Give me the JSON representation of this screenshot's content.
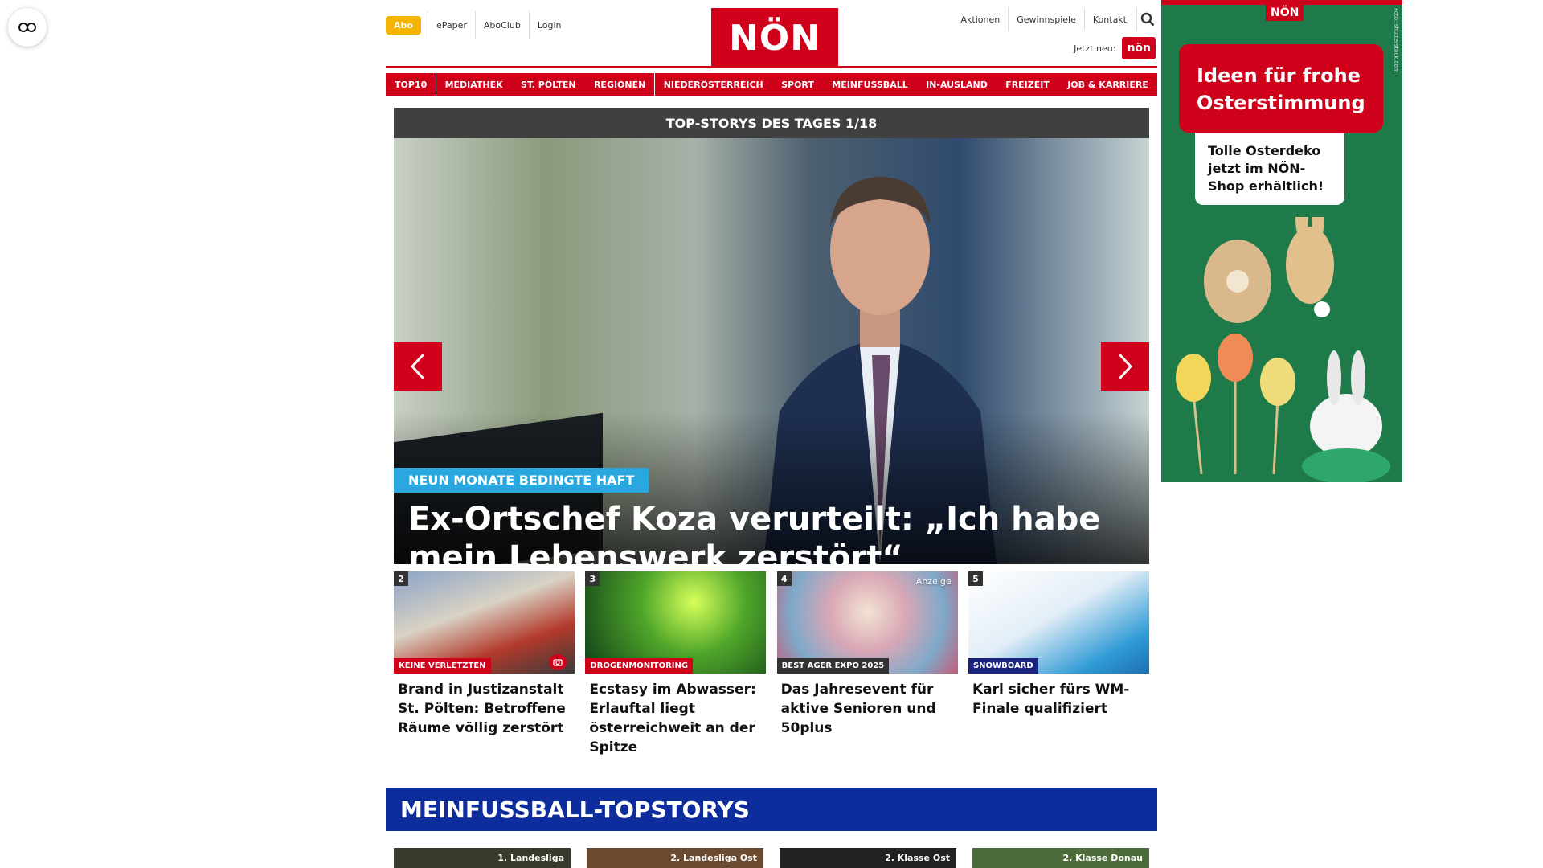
{
  "accessibility": {
    "label": ""
  },
  "header": {
    "abo": "Abo",
    "left_links": [
      "ePaper",
      "AboClub",
      "Login"
    ],
    "logo": "NÖN",
    "right_links": [
      "Aktionen",
      "Gewinnspiele",
      "Kontakt"
    ],
    "jetzt_neu": "Jetzt neu:",
    "jetzt_badge": "nön"
  },
  "nav": [
    "TOP10",
    "MEDIATHEK",
    "ST. PÖLTEN",
    "REGIONEN",
    "NIEDERÖSTERREICH",
    "SPORT",
    "MEINFUSSBALL",
    "IN-AUSLAND",
    "FREIZEIT",
    "JOB & KARRIERE"
  ],
  "hero": {
    "bar_title": "TOP-STORYS DES TAGES 1/18",
    "kicker": "NEUN MONATE BEDINGTE HAFT",
    "title": "Ex-Ortschef Koza verurteilt: „Ich habe mein Lebenswerk zerstört“"
  },
  "cards": [
    {
      "num": "2",
      "kicker": "KEINE VERLETZTEN",
      "title": "Brand in Justizanstalt St. Pölten: Betroffene Räume völlig zerstört"
    },
    {
      "num": "3",
      "kicker": "DROGENMONITORING",
      "title": "Ecstasy im Abwasser: Erlauftal liegt österreichweit an der Spitze"
    },
    {
      "num": "4",
      "kicker": "BEST AGER EXPO 2025",
      "ad_label": "Anzeige",
      "title": "Das Jahresevent für aktive Senioren und 50plus"
    },
    {
      "num": "5",
      "kicker": "SNOWBOARD",
      "title": "Karl sicher fürs WM-Finale qualifiziert"
    }
  ],
  "section": {
    "title": "MEINFUSSBALL-TOPSTORYS"
  },
  "bottom_cards": [
    "1. Landesliga",
    "2. Landesliga Ost",
    "2. Klasse Ost",
    "2. Klasse Donau"
  ],
  "ad": {
    "logo": "NÖN",
    "headline": "Ideen für frohe Osterstimmung",
    "sub": "Tolle Osterdeko jetzt im NÖN-Shop erhältlich!",
    "side": "Foto: shutterstock.com"
  }
}
